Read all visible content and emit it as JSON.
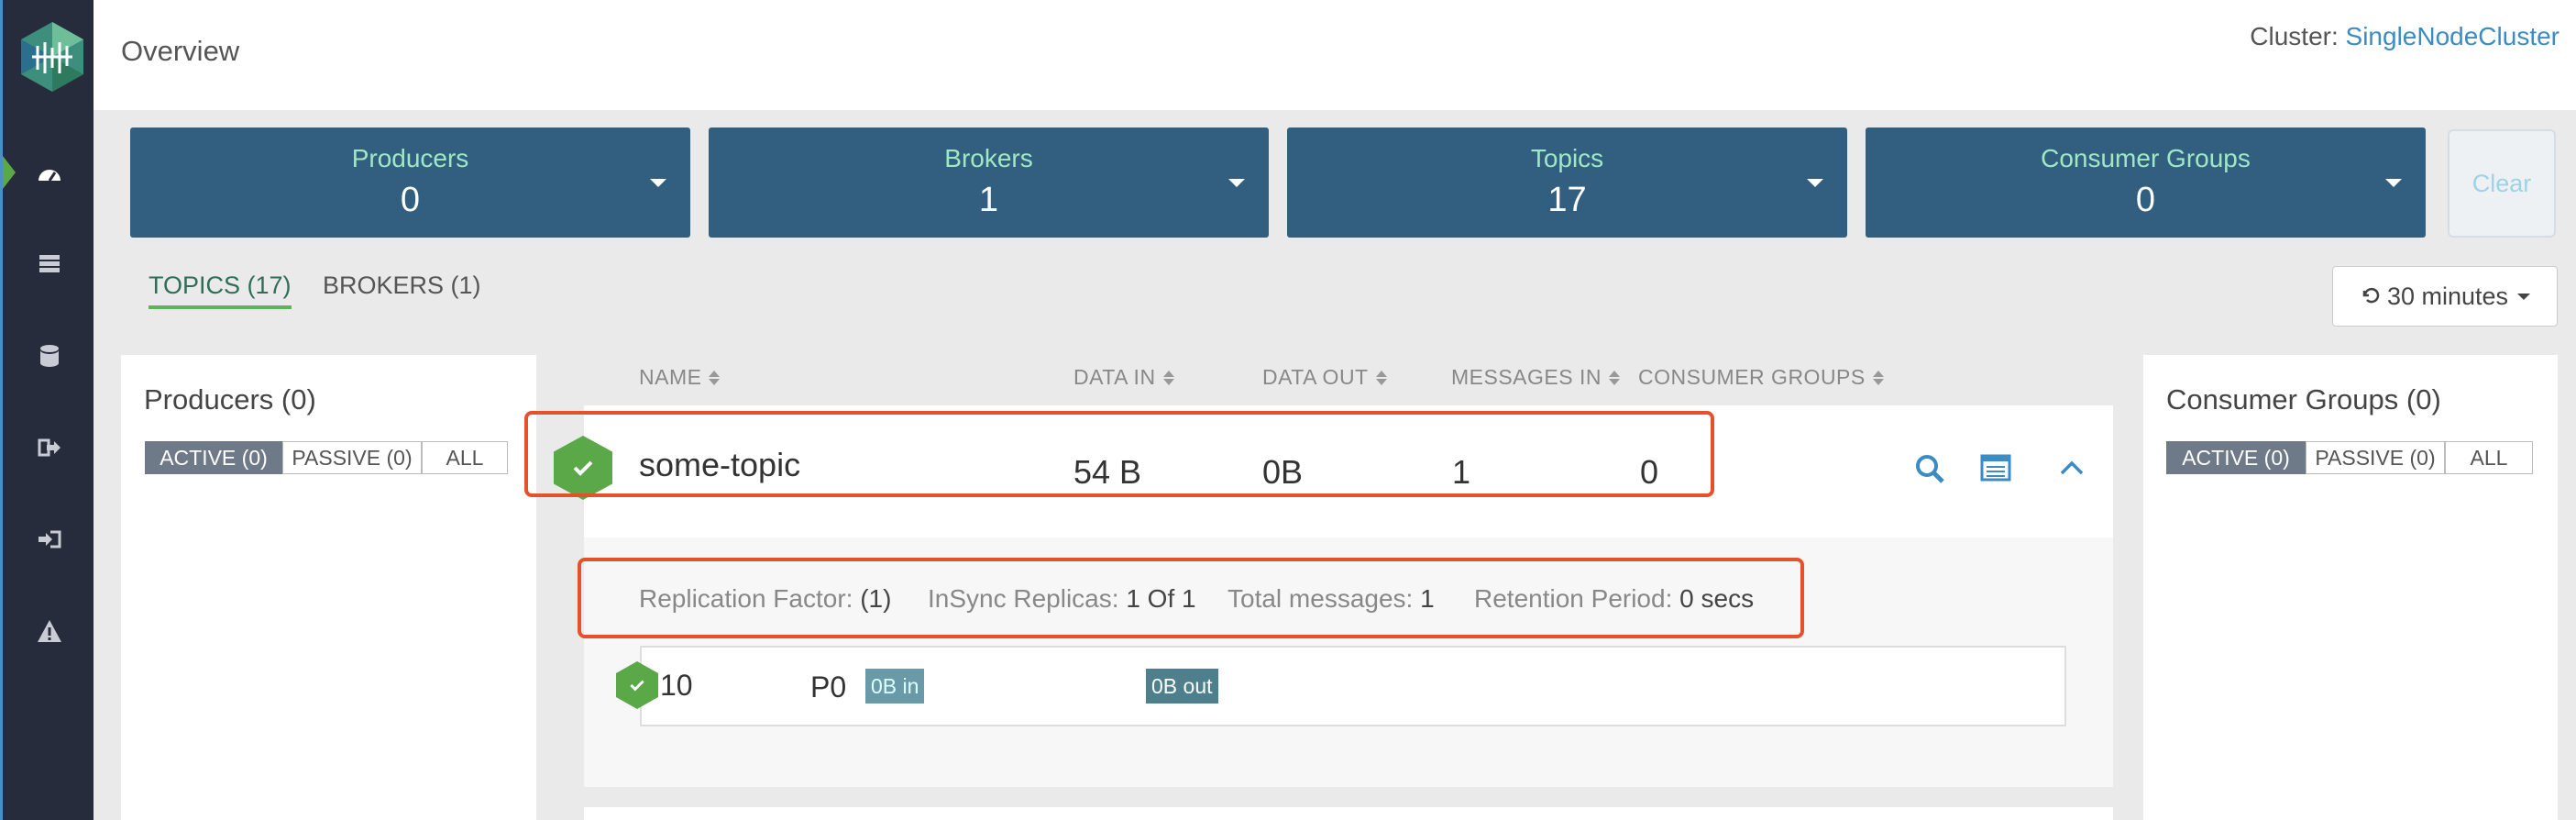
{
  "header": {
    "title": "Overview",
    "cluster_label": "Cluster:",
    "cluster_value": "SingleNodeCluster"
  },
  "summary_cards": [
    {
      "label": "Producers",
      "value": "0"
    },
    {
      "label": "Brokers",
      "value": "1"
    },
    {
      "label": "Topics",
      "value": "17"
    },
    {
      "label": "Consumer Groups",
      "value": "0"
    }
  ],
  "clear_label": "Clear",
  "tabs": [
    {
      "label": "TOPICS (17)",
      "active": true
    },
    {
      "label": "BROKERS (1)",
      "active": false
    }
  ],
  "time_range": "30 minutes",
  "producers_panel": {
    "title": "Producers (0)",
    "filters": [
      "ACTIVE (0)",
      "PASSIVE (0)",
      "ALL"
    ]
  },
  "consumers_panel": {
    "title": "Consumer Groups (0)",
    "filters": [
      "ACTIVE (0)",
      "PASSIVE (0)",
      "ALL"
    ]
  },
  "columns": [
    "NAME",
    "DATA IN",
    "DATA OUT",
    "MESSAGES IN",
    "CONSUMER GROUPS"
  ],
  "topic": {
    "name": "some-topic",
    "data_in": "54 B",
    "data_out": "0B",
    "messages_in": "1",
    "consumer_groups": "0",
    "status": "healthy"
  },
  "details": {
    "replication_label": "Replication Factor:",
    "replication_value": "(1)",
    "insync_label": "InSync Replicas:",
    "insync_value": "1 Of 1",
    "total_label": "Total messages:",
    "total_value": "1",
    "retention_label": "Retention Period:",
    "retention_value": "0 secs"
  },
  "partition": {
    "broker": "10",
    "partition": "P0",
    "in": "0B in",
    "out": "0B out"
  },
  "icons": [
    "logo",
    "dashboard-icon",
    "servers-icon",
    "database-icon",
    "sign-out-icon",
    "sign-in-icon",
    "warning-icon",
    "search-icon",
    "config-icon",
    "chevron-up-icon",
    "check-icon",
    "refresh-icon"
  ],
  "colors": {
    "sidebar": "#272c3c",
    "card": "#325f80",
    "card_label": "#9fe7c5",
    "highlight": "#e4512a",
    "healthy": "#5aa848",
    "link": "#3b8bc4"
  }
}
